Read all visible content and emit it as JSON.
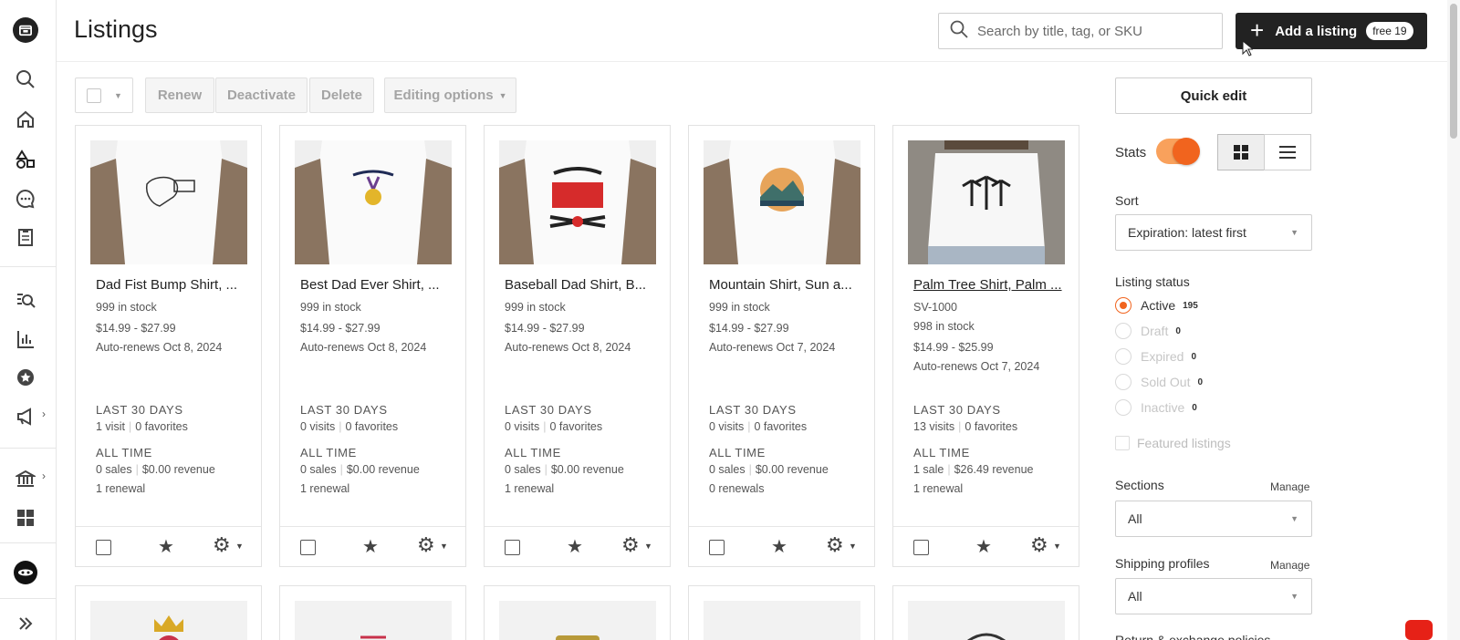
{
  "colors": {
    "accent": "#f1641e",
    "primary_button": "#222222"
  },
  "rail": {
    "items": [
      {
        "icon": "shop-icon"
      },
      {
        "icon": "search-icon"
      },
      {
        "icon": "home-icon"
      },
      {
        "icon": "listings-icon"
      },
      {
        "icon": "messages-icon"
      },
      {
        "icon": "orders-icon"
      },
      {
        "icon": "marketing-search-icon"
      },
      {
        "icon": "stats-icon"
      },
      {
        "icon": "star-seller-icon"
      },
      {
        "icon": "megaphone-icon"
      },
      {
        "icon": "finances-icon"
      },
      {
        "icon": "apps-grid-icon"
      },
      {
        "icon": "avatar"
      },
      {
        "icon": "expand-icon"
      }
    ]
  },
  "header": {
    "title": "Listings",
    "search_placeholder": "Search by title, tag, or SKU",
    "add_label": "Add a listing",
    "free_badge": "free 19"
  },
  "toolbar": {
    "renew": "Renew",
    "deactivate": "Deactivate",
    "delete": "Delete",
    "editing_options": "Editing options"
  },
  "listings": [
    {
      "title": "Dad Fist Bump Shirt, ...",
      "sku": "",
      "stock": "999 in stock",
      "price": "$14.99 - $27.99",
      "renews": "Auto-renews Oct 8, 2024",
      "last30_label": "LAST 30 DAYS",
      "visits": "1 visit",
      "favorites": "0 favorites",
      "alltime_label": "ALL TIME",
      "sales": "0 sales",
      "revenue": "$0.00 revenue",
      "renewals": "1 renewal"
    },
    {
      "title": "Best Dad Ever Shirt, ...",
      "sku": "",
      "stock": "999 in stock",
      "price": "$14.99 - $27.99",
      "renews": "Auto-renews Oct 8, 2024",
      "last30_label": "LAST 30 DAYS",
      "visits": "0 visits",
      "favorites": "0 favorites",
      "alltime_label": "ALL TIME",
      "sales": "0 sales",
      "revenue": "$0.00 revenue",
      "renewals": "1 renewal"
    },
    {
      "title": "Baseball Dad Shirt, B...",
      "sku": "",
      "stock": "999 in stock",
      "price": "$14.99 - $27.99",
      "renews": "Auto-renews Oct 8, 2024",
      "last30_label": "LAST 30 DAYS",
      "visits": "0 visits",
      "favorites": "0 favorites",
      "alltime_label": "ALL TIME",
      "sales": "0 sales",
      "revenue": "$0.00 revenue",
      "renewals": "1 renewal"
    },
    {
      "title": "Mountain Shirt, Sun a...",
      "sku": "",
      "stock": "999 in stock",
      "price": "$14.99 - $27.99",
      "renews": "Auto-renews Oct 7, 2024",
      "last30_label": "LAST 30 DAYS",
      "visits": "0 visits",
      "favorites": "0 favorites",
      "alltime_label": "ALL TIME",
      "sales": "0 sales",
      "revenue": "$0.00 revenue",
      "renewals": "0 renewals"
    },
    {
      "title": "Palm Tree Shirt, Palm ...",
      "sku": "SV-1000",
      "stock": "998 in stock",
      "price": "$14.99 - $25.99",
      "renews": "Auto-renews Oct 7, 2024",
      "last30_label": "LAST 30 DAYS",
      "visits": "13 visits",
      "favorites": "0 favorites",
      "alltime_label": "ALL TIME",
      "sales": "1 sale",
      "revenue": "$26.49 revenue",
      "renewals": "1 renewal"
    }
  ],
  "panel": {
    "quick_edit": "Quick edit",
    "stats_label": "Stats",
    "stats_on": true,
    "sort_label": "Sort",
    "sort_value": "Expiration: latest first",
    "status_label": "Listing status",
    "statuses": [
      {
        "label": "Active",
        "count": "195",
        "selected": true
      },
      {
        "label": "Draft",
        "count": "0",
        "selected": false
      },
      {
        "label": "Expired",
        "count": "0",
        "selected": false
      },
      {
        "label": "Sold Out",
        "count": "0",
        "selected": false
      },
      {
        "label": "Inactive",
        "count": "0",
        "selected": false
      }
    ],
    "featured": "Featured listings",
    "sections_label": "Sections",
    "sections_manage": "Manage",
    "sections_value": "All",
    "shipping_label": "Shipping profiles",
    "shipping_manage": "Manage",
    "shipping_value": "All",
    "return_label": "Return & exchange policies"
  }
}
